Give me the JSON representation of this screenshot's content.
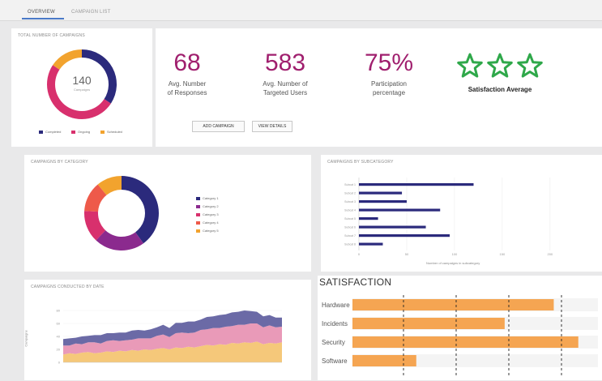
{
  "tabs": [
    {
      "label": "OVERVIEW",
      "active": true
    },
    {
      "label": "CAMPAIGN LIST",
      "active": false
    }
  ],
  "total_panel": {
    "title": "TOTAL NUMBER OF CAMPAIGNS",
    "total": "140",
    "total_sub": "Campaigns",
    "legend": [
      {
        "label": "Completed",
        "color": "#2b2a7c"
      },
      {
        "label": "Ongoing",
        "color": "#d8306d"
      },
      {
        "label": "Scheduled",
        "color": "#f2a32e"
      }
    ]
  },
  "stats": [
    {
      "value": "68",
      "label1": "Avg. Number",
      "label2": "of Responses"
    },
    {
      "value": "583",
      "label1": "Avg. Number of",
      "label2": "Targeted Users"
    },
    {
      "value": "75%",
      "label1": "Participation",
      "label2": "percentage"
    }
  ],
  "satisfaction_avg": {
    "label": "Satisfaction Average",
    "stars": 3,
    "star_color": "#2fa84a"
  },
  "buttons": {
    "add": "ADD CAMPAIGN",
    "view": "VIEW DETAILS"
  },
  "category_panel": {
    "title": "CAMPAIGNS BY CATEGORY",
    "legend": [
      {
        "label": "Category 1",
        "color": "#2b2a7c"
      },
      {
        "label": "Category 2",
        "color": "#8b2a8e"
      },
      {
        "label": "Category 3",
        "color": "#d8306d"
      },
      {
        "label": "Category 4",
        "color": "#ee5a4a"
      },
      {
        "label": "Category 5",
        "color": "#f2a32e"
      }
    ]
  },
  "subcategory_panel": {
    "title": "CAMPAIGNS BY SUBCATEGORY",
    "xlabel": "Number of campaigns in subcategory"
  },
  "time_panel": {
    "title": "CAMPAIGNS CONDUCTED BY DATE",
    "ylabel": "Campaigns"
  },
  "satisfaction": {
    "title": "SATISFACTION",
    "rows": [
      "Hardware",
      "Incidents",
      "Security",
      "Software"
    ]
  },
  "colors": {
    "accent": "#4a7ac8",
    "stat": "#a01f6e",
    "bar": "#2b2a7c",
    "satisfaction": "#f5a552"
  },
  "chart_data": [
    {
      "type": "pie",
      "title": "TOTAL NUMBER OF CAMPAIGNS",
      "labels": [
        "Completed",
        "Ongoing",
        "Scheduled"
      ],
      "values": [
        48,
        70,
        22
      ],
      "colors": [
        "#2b2a7c",
        "#d8306d",
        "#f2a32e"
      ]
    },
    {
      "type": "pie",
      "title": "CAMPAIGNS BY CATEGORY",
      "labels": [
        "Category 1",
        "Category 2",
        "Category 3",
        "Category 4",
        "Category 5"
      ],
      "values": [
        40,
        22,
        14,
        13,
        11
      ],
      "colors": [
        "#2b2a7c",
        "#8b2a8e",
        "#d8306d",
        "#ee5a4a",
        "#f2a32e"
      ]
    },
    {
      "type": "bar",
      "orientation": "horizontal",
      "title": "CAMPAIGNS BY SUBCATEGORY",
      "categories": [
        "Subcat 1",
        "Subcat 2",
        "Subcat 3",
        "Subcat 4",
        "Subcat 5",
        "Subcat 6",
        "Subcat 7",
        "Subcat 8"
      ],
      "values": [
        120,
        45,
        50,
        85,
        20,
        70,
        95,
        25
      ],
      "xlabel": "Number of campaigns in subcategory",
      "xlim": [
        0,
        240
      ],
      "xticks": [
        0,
        50,
        100,
        150,
        200
      ]
    },
    {
      "type": "area",
      "title": "CAMPAIGNS CONDUCTED BY DATE",
      "ylabel": "Campaigns",
      "ylim": [
        0,
        100
      ],
      "series": [
        {
          "name": "Series 1",
          "color": "#f5c87a",
          "values": [
            12,
            14,
            13,
            15,
            16,
            14,
            15,
            17,
            16,
            18,
            17,
            19,
            18,
            20,
            19,
            21,
            22,
            20,
            23,
            22,
            24,
            23,
            25,
            27,
            26,
            28,
            27,
            30,
            29,
            31,
            30,
            32,
            28,
            30,
            29,
            31
          ]
        },
        {
          "name": "Series 2",
          "color": "#e99ab8",
          "values": [
            14,
            12,
            16,
            13,
            15,
            17,
            14,
            16,
            18,
            15,
            17,
            16,
            19,
            17,
            18,
            20,
            21,
            19,
            22,
            24,
            21,
            23,
            25,
            24,
            27,
            25,
            28,
            26,
            29,
            27,
            30,
            28,
            26,
            27,
            25,
            24
          ]
        },
        {
          "name": "Series 3",
          "color": "#6b6aa6",
          "values": [
            10,
            11,
            9,
            12,
            10,
            11,
            13,
            12,
            11,
            13,
            12,
            14,
            13,
            12,
            14,
            13,
            15,
            14,
            16,
            15,
            18,
            17,
            16,
            19,
            18,
            20,
            19,
            21,
            20,
            22,
            19,
            18,
            17,
            16,
            15,
            14
          ]
        }
      ]
    },
    {
      "type": "bar",
      "orientation": "horizontal",
      "title": "SATISFACTION",
      "categories": [
        "Hardware",
        "Incidents",
        "Security",
        "Software"
      ],
      "values": [
        82,
        62,
        92,
        26
      ],
      "xlim": [
        0,
        100
      ]
    }
  ]
}
